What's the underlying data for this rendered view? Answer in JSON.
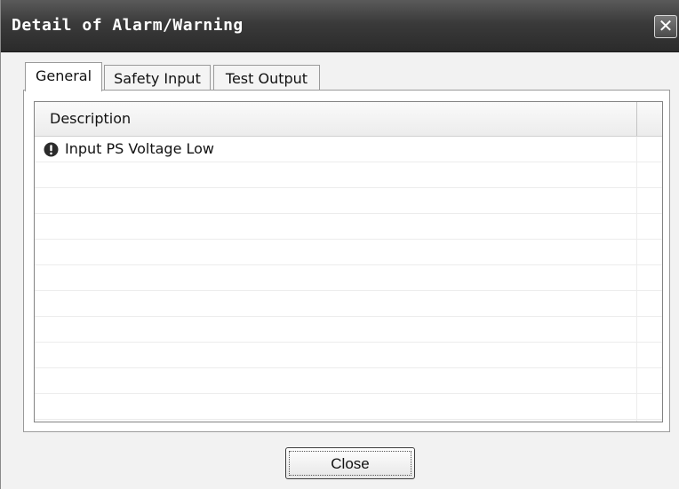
{
  "window": {
    "title": "Detail of Alarm/Warning",
    "close_glyph": "✕"
  },
  "tabs": [
    {
      "label": "General",
      "active": true
    },
    {
      "label": "Safety Input",
      "active": false
    },
    {
      "label": "Test Output",
      "active": false
    }
  ],
  "list": {
    "columns": [
      "Description"
    ],
    "rows": [
      {
        "icon": "alarm-exclamation-icon",
        "text": "Input PS Voltage Low"
      }
    ]
  },
  "footer": {
    "close_label": "Close"
  }
}
